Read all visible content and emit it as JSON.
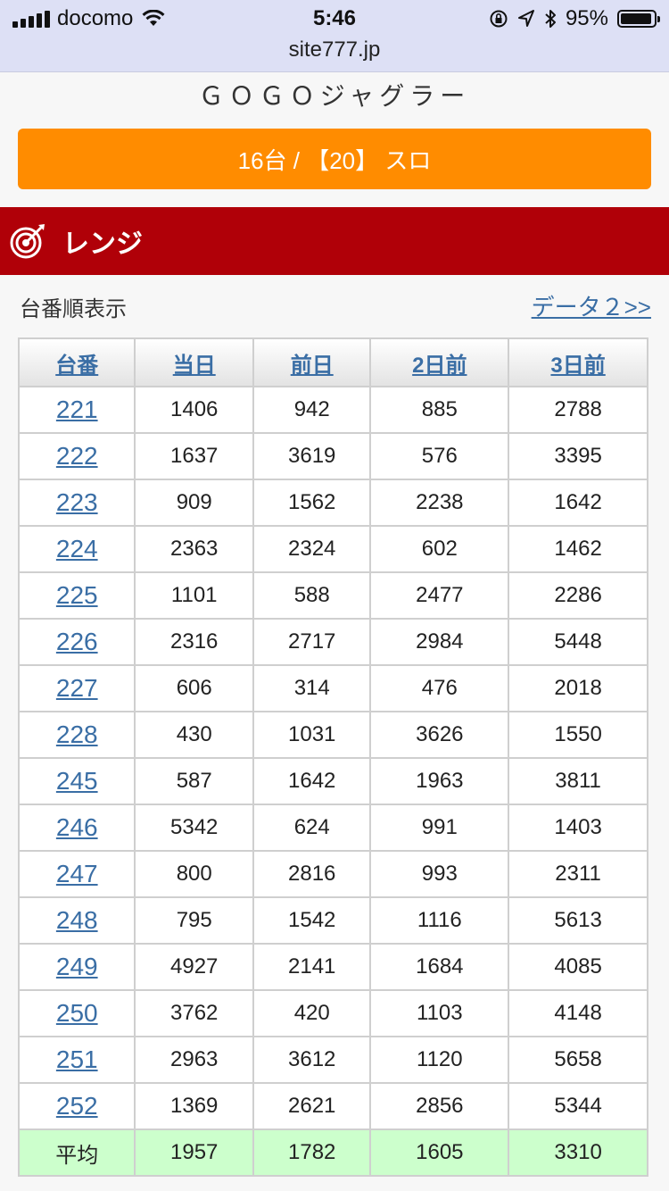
{
  "status_bar": {
    "carrier": "docomo",
    "time": "5:46",
    "battery": "95%",
    "battery_level": 0.95
  },
  "browser": {
    "url": "site777.jp"
  },
  "machine_name": "ＧＯＧＯジャグラー",
  "machine_info_button": "16台 / 【20】 スロ",
  "section": {
    "title": "レンジ",
    "icon": "target-dart-icon"
  },
  "order_label": "台番順表示",
  "data2_link": "データ２>>",
  "table": {
    "headers": [
      "台番",
      "当日",
      "前日",
      "2日前",
      "3日前"
    ],
    "rows": [
      {
        "no": "221",
        "values": [
          "1406",
          "942",
          "885",
          "2788"
        ]
      },
      {
        "no": "222",
        "values": [
          "1637",
          "3619",
          "576",
          "3395"
        ]
      },
      {
        "no": "223",
        "values": [
          "909",
          "1562",
          "2238",
          "1642"
        ]
      },
      {
        "no": "224",
        "values": [
          "2363",
          "2324",
          "602",
          "1462"
        ]
      },
      {
        "no": "225",
        "values": [
          "1101",
          "588",
          "2477",
          "2286"
        ]
      },
      {
        "no": "226",
        "values": [
          "2316",
          "2717",
          "2984",
          "5448"
        ]
      },
      {
        "no": "227",
        "values": [
          "606",
          "314",
          "476",
          "2018"
        ]
      },
      {
        "no": "228",
        "values": [
          "430",
          "1031",
          "3626",
          "1550"
        ]
      },
      {
        "no": "245",
        "values": [
          "587",
          "1642",
          "1963",
          "3811"
        ]
      },
      {
        "no": "246",
        "values": [
          "5342",
          "624",
          "991",
          "1403"
        ]
      },
      {
        "no": "247",
        "values": [
          "800",
          "2816",
          "993",
          "2311"
        ]
      },
      {
        "no": "248",
        "values": [
          "795",
          "1542",
          "1116",
          "5613"
        ]
      },
      {
        "no": "249",
        "values": [
          "4927",
          "2141",
          "1684",
          "4085"
        ]
      },
      {
        "no": "250",
        "values": [
          "3762",
          "420",
          "1103",
          "4148"
        ]
      },
      {
        "no": "251",
        "values": [
          "2963",
          "3612",
          "1120",
          "5658"
        ]
      },
      {
        "no": "252",
        "values": [
          "1369",
          "2621",
          "2856",
          "5344"
        ]
      }
    ],
    "average": {
      "label": "平均",
      "values": [
        "1957",
        "1782",
        "1605",
        "3310"
      ]
    }
  },
  "colors": {
    "orange": "#ff8c00",
    "section_red": "#b00008",
    "link_blue": "#3a6ea5",
    "average_green": "#ccffcc"
  }
}
